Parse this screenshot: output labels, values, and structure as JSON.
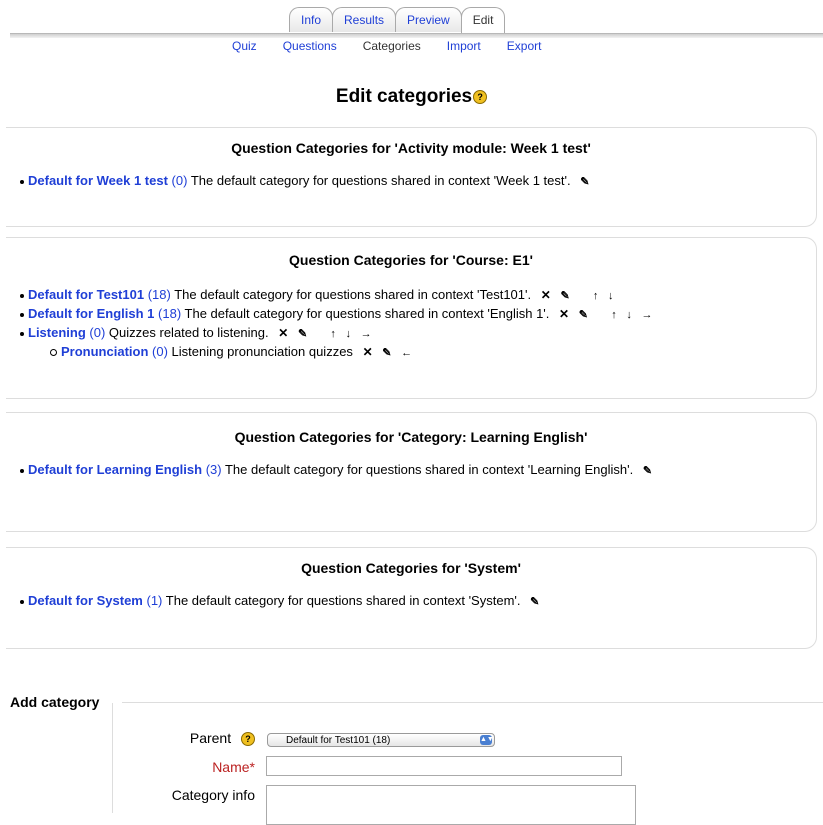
{
  "tabs": [
    {
      "label": "Info"
    },
    {
      "label": "Results"
    },
    {
      "label": "Preview"
    },
    {
      "label": "Edit",
      "active": true
    }
  ],
  "subtabs": [
    {
      "label": "Quiz"
    },
    {
      "label": "Questions"
    },
    {
      "label": "Categories",
      "current": true
    },
    {
      "label": "Import"
    },
    {
      "label": "Export"
    }
  ],
  "page": {
    "title": "Edit categories"
  },
  "sections": [
    {
      "heading": "Question Categories for 'Activity module: Week 1 test'",
      "items": [
        {
          "name": "Default for Week 1 test",
          "count": "(0)",
          "desc": "The default category for questions shared in context 'Week 1 test'."
        }
      ]
    },
    {
      "heading": "Question Categories for 'Course: E1'",
      "items": [
        {
          "name": "Default for Test101",
          "count": "(18)",
          "desc": "The default category for questions shared in context 'Test101'."
        },
        {
          "name": "Default for English 1",
          "count": "(18)",
          "desc": "The default category for questions shared in context 'English 1'."
        },
        {
          "name": "Listening",
          "count": "(0)",
          "desc": "Quizzes related to listening."
        },
        {
          "name": "Pronunciation",
          "count": "(0)",
          "desc": "Listening pronunciation quizzes"
        }
      ]
    },
    {
      "heading": "Question Categories for 'Category: Learning English'",
      "items": [
        {
          "name": "Default for Learning English",
          "count": "(3)",
          "desc": "The default category for questions shared in context 'Learning English'."
        }
      ]
    },
    {
      "heading": "Question Categories for 'System'",
      "items": [
        {
          "name": "Default for System",
          "count": "(1)",
          "desc": "The default category for questions shared in context 'System'."
        }
      ]
    }
  ],
  "icons": {
    "help": "?",
    "delete": "✕",
    "edit": "✎",
    "up": "↑",
    "down": "↓",
    "right": "→",
    "left": "←"
  },
  "add_category": {
    "legend": "Add category",
    "parent_label": "Parent",
    "parent_value": "Default for Test101 (18)",
    "name_label": "Name",
    "required_mark": "*",
    "info_label": "Category info"
  }
}
